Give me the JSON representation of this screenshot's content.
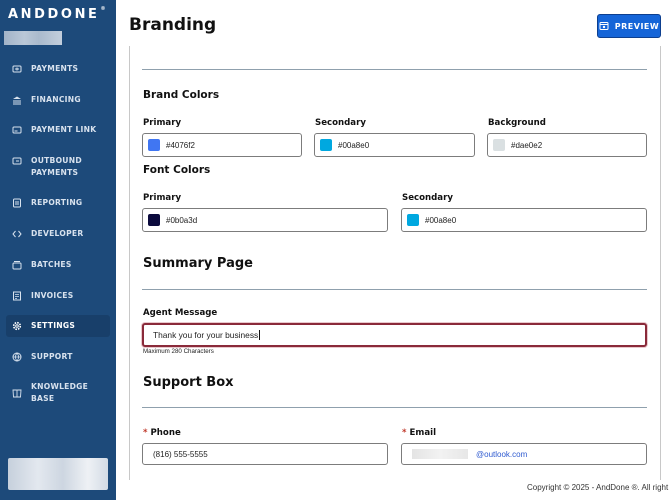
{
  "sidebar": {
    "logo": "ANDDONE",
    "logo_mark": "®",
    "items": [
      {
        "label": "PAYMENTS",
        "icon": "payments-icon"
      },
      {
        "label": "FINANCING",
        "icon": "bank-icon"
      },
      {
        "label": "PAYMENT LINK",
        "icon": "link-card-icon"
      },
      {
        "label": "OUTBOUND",
        "label2": "PAYMENTS",
        "icon": "outbound-icon"
      },
      {
        "label": "REPORTING",
        "icon": "report-icon"
      },
      {
        "label": "DEVELOPER",
        "icon": "code-icon"
      },
      {
        "label": "BATCHES",
        "icon": "batches-icon"
      },
      {
        "label": "INVOICES",
        "icon": "invoice-icon"
      },
      {
        "label": "SETTINGS",
        "icon": "gear-icon",
        "active": true
      },
      {
        "label": "SUPPORT",
        "icon": "globe-icon"
      },
      {
        "label": "KNOWLEDGE BASE",
        "icon": "book-icon"
      }
    ]
  },
  "header": {
    "title": "Branding",
    "preview_label": "PREVIEW"
  },
  "brand_colors": {
    "heading": "Brand Colors",
    "primary": {
      "label": "Primary",
      "value": "#4076f2"
    },
    "secondary": {
      "label": "Secondary",
      "value": "#00a8e0"
    },
    "background": {
      "label": "Background",
      "value": "#dae0e2"
    }
  },
  "font_colors": {
    "heading": "Font Colors",
    "primary": {
      "label": "Primary",
      "value": "#0b0a3d"
    },
    "secondary": {
      "label": "Secondary",
      "value": "#00a8e0"
    }
  },
  "summary_page": {
    "heading": "Summary Page",
    "agent_message_label": "Agent Message",
    "agent_message_value": "Thank you for your business",
    "help_text": "Maximum 280 Characters"
  },
  "support_box": {
    "heading": "Support Box",
    "required_mark": "*",
    "phone_label": "Phone",
    "phone_value": "(816) 555-5555",
    "email_label": "Email",
    "email_domain": "@outlook.com"
  },
  "footer": {
    "copyright": "Copyright © 2025 - AndDone ®. All right"
  },
  "colors": {
    "sidebar_bg": "#1d4a7a",
    "accent": "#1565d8",
    "focus_border": "#8a2a3a"
  }
}
